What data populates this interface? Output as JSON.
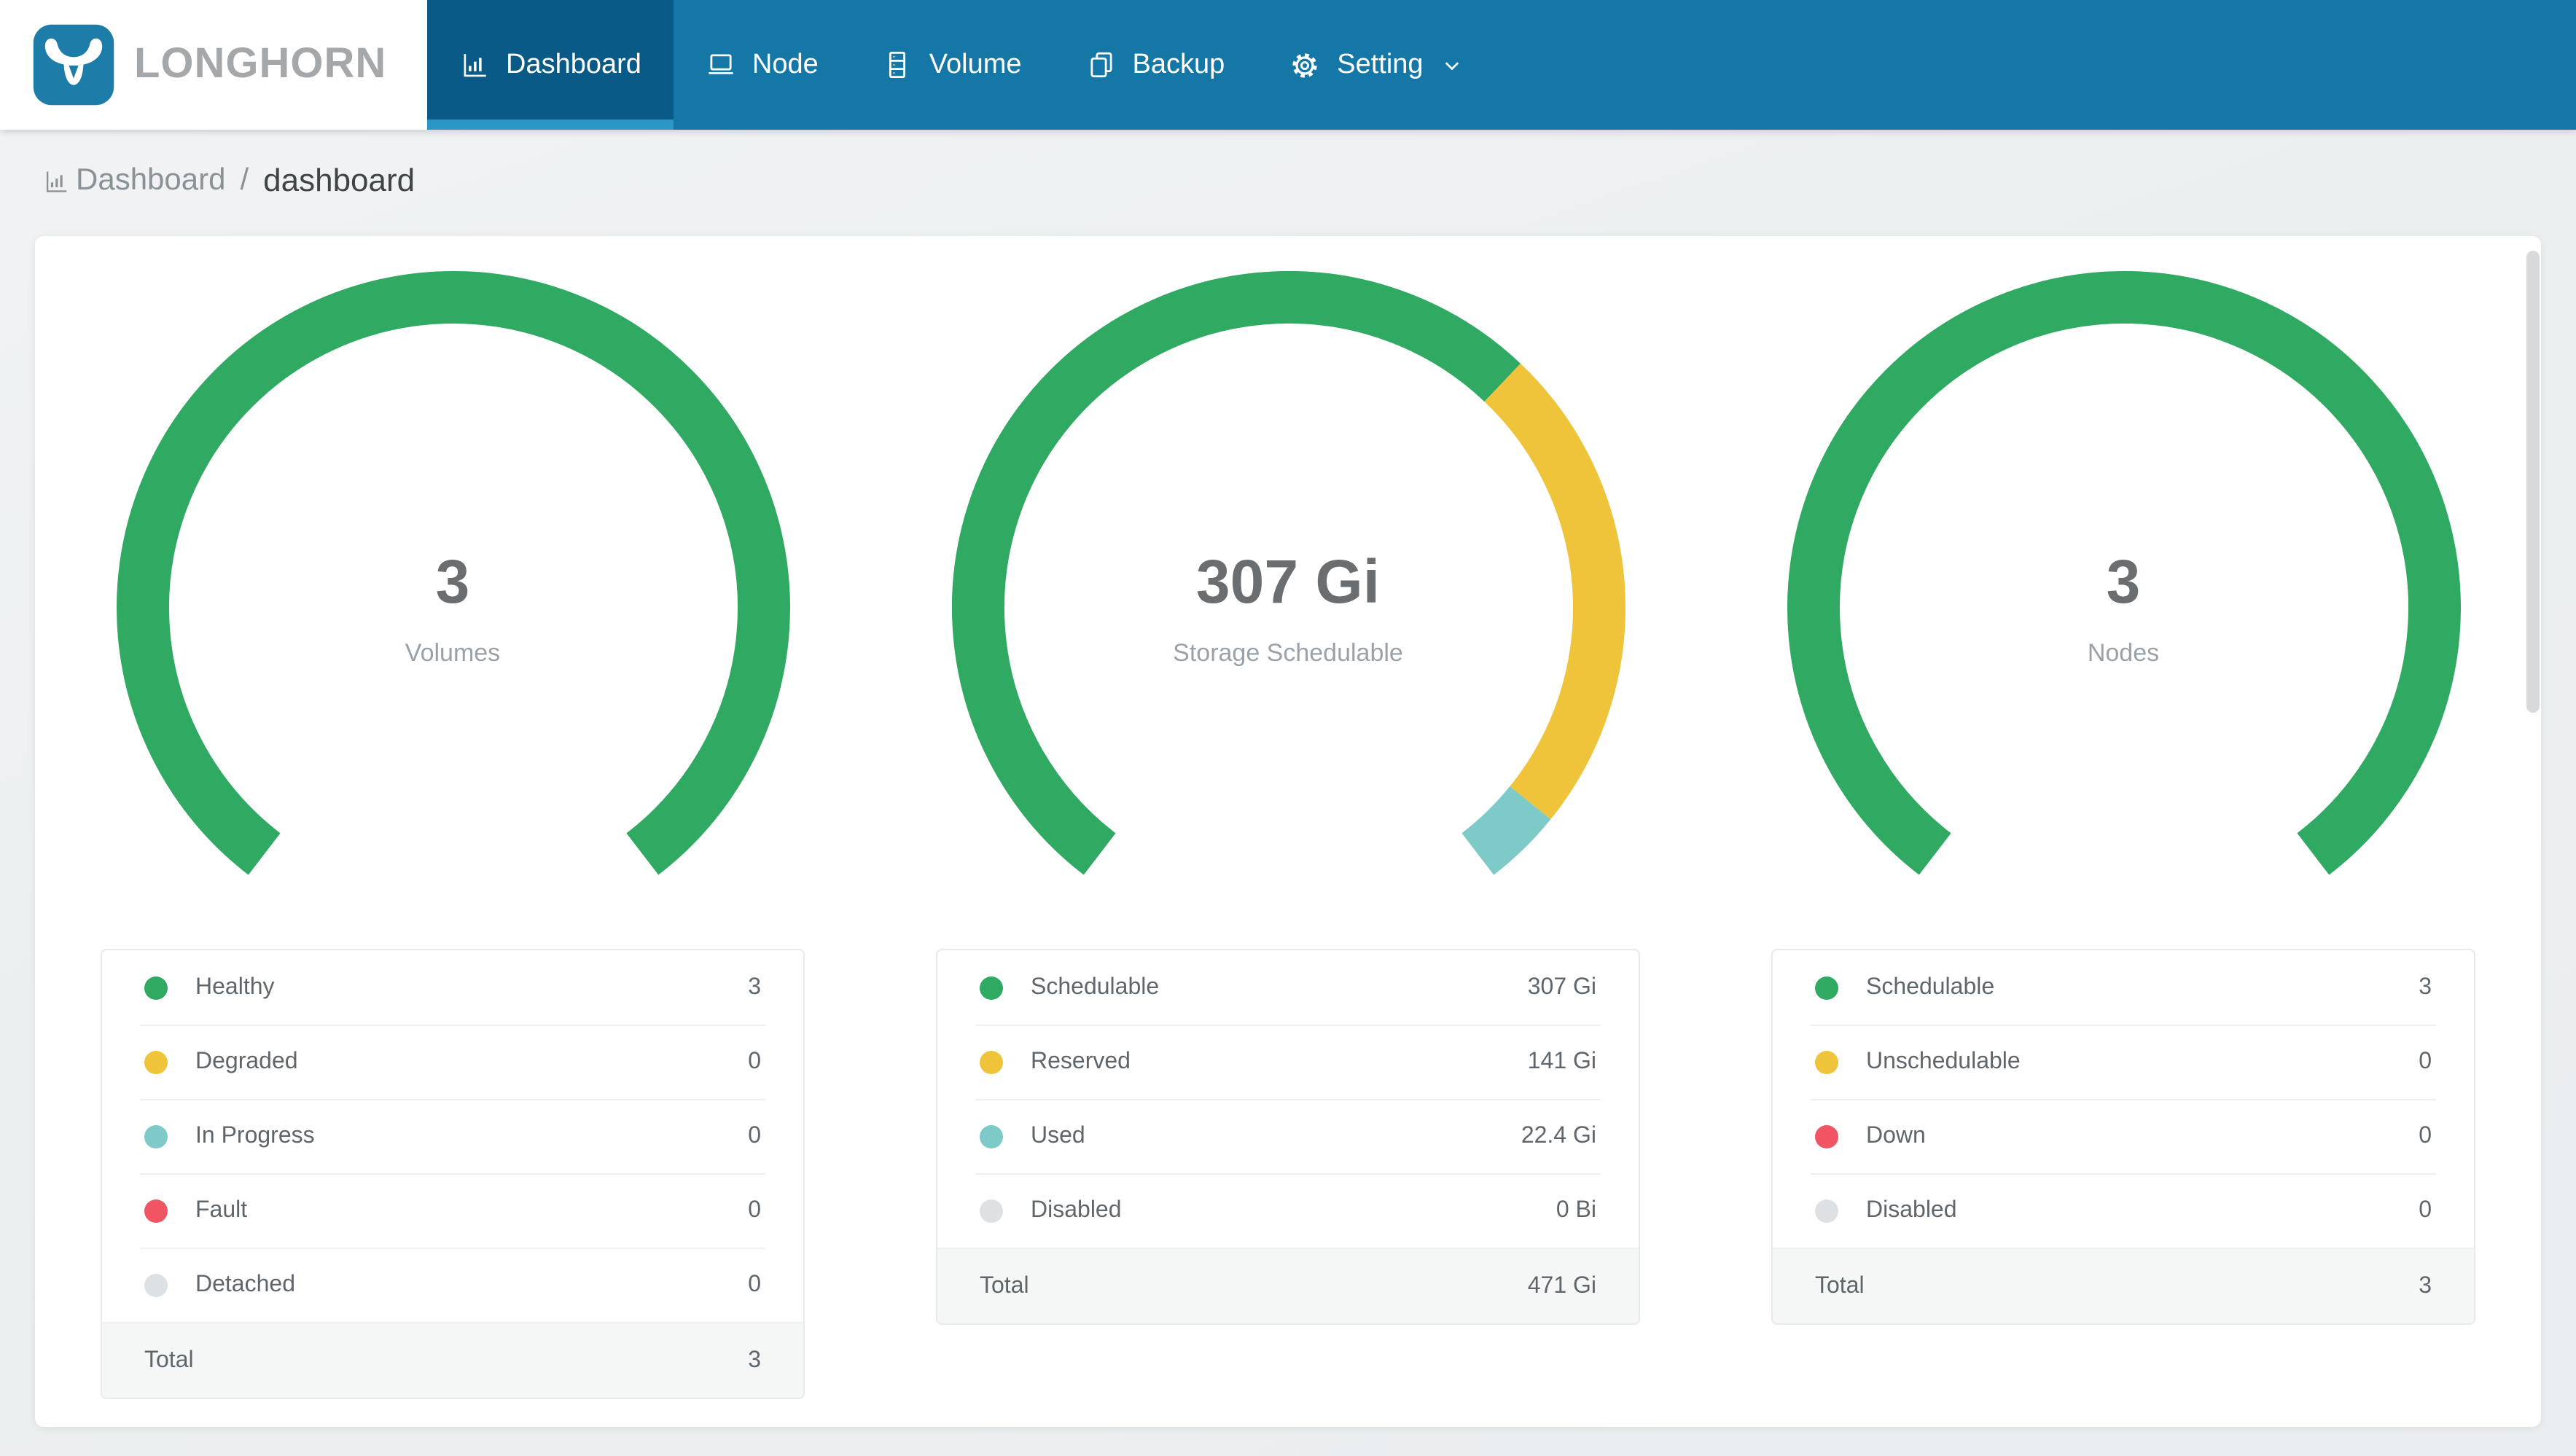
{
  "brand": {
    "name": "LONGHORN"
  },
  "nav": {
    "items": [
      {
        "label": "Dashboard",
        "icon": "bar-chart-icon",
        "active": true
      },
      {
        "label": "Node",
        "icon": "laptop-icon",
        "active": false
      },
      {
        "label": "Volume",
        "icon": "server-stack-icon",
        "active": false
      },
      {
        "label": "Backup",
        "icon": "copy-icon",
        "active": false
      },
      {
        "label": "Setting",
        "icon": "gear-icon",
        "active": false,
        "has_dropdown": true
      }
    ]
  },
  "breadcrumb": {
    "icon": "bar-chart-icon",
    "root": "Dashboard",
    "separator": "/",
    "current": "dashboard"
  },
  "colors": {
    "navbar_bg": "#1577a6",
    "active_tab_bg": "#0a5a87",
    "active_tab_underline": "#2b97c4",
    "logo_tile_blue": "#1e7ca8",
    "brand_text_gray": "#a5a8ab",
    "healthy_green": "#30a962",
    "warning_yellow": "#f0c43a",
    "info_teal": "#7dcac9",
    "error_red": "#ef5562",
    "disabled_gray": "#dee1e3",
    "page_bg": "#edf0f1"
  },
  "chart_data": [
    {
      "type": "donut",
      "name": "volumes",
      "center_value": "3",
      "center_label": "Volumes",
      "arc": {
        "start_deg": 127.5,
        "sweep_deg": 285,
        "direction": "clockwise"
      },
      "segments": [
        {
          "label": "Healthy",
          "value": 3,
          "display": "3",
          "color": "#30a962"
        },
        {
          "label": "Degraded",
          "value": 0,
          "display": "0",
          "color": "#f0c43a"
        },
        {
          "label": "In Progress",
          "value": 0,
          "display": "0",
          "color": "#7dcac9"
        },
        {
          "label": "Fault",
          "value": 0,
          "display": "0",
          "color": "#ef5562"
        },
        {
          "label": "Detached",
          "value": 0,
          "display": "0",
          "color": "#dee1e3"
        }
      ],
      "total": {
        "label": "Total",
        "display": "3"
      }
    },
    {
      "type": "donut",
      "name": "storage-schedulable",
      "center_value": "307 Gi",
      "center_label": "Storage Schedulable",
      "arc": {
        "start_deg": 127.5,
        "sweep_deg": 285,
        "direction": "clockwise"
      },
      "segments": [
        {
          "label": "Schedulable",
          "value": 307,
          "display": "307 Gi",
          "color": "#30a962"
        },
        {
          "label": "Reserved",
          "value": 141,
          "display": "141 Gi",
          "color": "#f0c43a"
        },
        {
          "label": "Used",
          "value": 22.4,
          "display": "22.4 Gi",
          "color": "#7dcac9"
        },
        {
          "label": "Disabled",
          "value": 0,
          "display": "0 Bi",
          "color": "#dee1e3"
        }
      ],
      "total": {
        "label": "Total",
        "display": "471 Gi"
      }
    },
    {
      "type": "donut",
      "name": "nodes",
      "center_value": "3",
      "center_label": "Nodes",
      "arc": {
        "start_deg": 127.5,
        "sweep_deg": 285,
        "direction": "clockwise"
      },
      "segments": [
        {
          "label": "Schedulable",
          "value": 3,
          "display": "3",
          "color": "#30a962"
        },
        {
          "label": "Unschedulable",
          "value": 0,
          "display": "0",
          "color": "#f0c43a"
        },
        {
          "label": "Down",
          "value": 0,
          "display": "0",
          "color": "#ef5562"
        },
        {
          "label": "Disabled",
          "value": 0,
          "display": "0",
          "color": "#dee1e3"
        }
      ],
      "total": {
        "label": "Total",
        "display": "3"
      }
    }
  ]
}
